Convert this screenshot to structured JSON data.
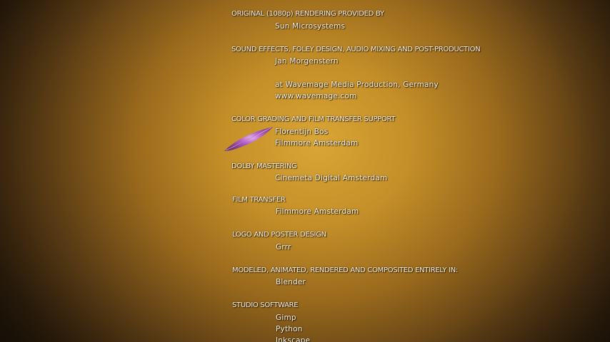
{
  "credits": [
    {
      "role": "ORIGINAL (1080p) RENDERING PROVIDED BY",
      "names": [
        "Sun Microsystems"
      ]
    },
    {
      "role": "SOUND EFFECTS, FOLEY DESIGN, AUDIO MIXING AND POST-PRODUCTION",
      "names": [
        "Jan Morgenstern",
        "",
        "at Wavemage Media Production, Germany",
        "www.wavemage.com"
      ]
    },
    {
      "role": "COLOR GRADING AND FILM TRANSFER SUPPORT",
      "names": [
        "Florentijn Bos",
        "Filmmore Amsterdam"
      ]
    },
    {
      "role": "DOLBY MASTERING",
      "names": [
        "Cinemeta Digital Amsterdam"
      ]
    },
    {
      "role": "FILM TRANSFER",
      "names": [
        "Filmmore Amsterdam"
      ]
    },
    {
      "role": "LOGO AND POSTER DESIGN",
      "names": [
        "Grrr"
      ]
    },
    {
      "role": "MODELED, ANIMATED, RENDERED AND COMPOSITED ENTIRELY IN:",
      "names": [
        "Blender"
      ]
    },
    {
      "role": "STUDIO SOFTWARE",
      "names": [
        "Gimp",
        "Python",
        "Inkscape"
      ]
    }
  ],
  "colors": {
    "background_center": "#d9a636",
    "background_edge": "#1e1408",
    "text": "#f4efe2",
    "leaf": "#9b3fc4"
  },
  "decorations": {
    "leaf_icon": "purple-leaf"
  }
}
